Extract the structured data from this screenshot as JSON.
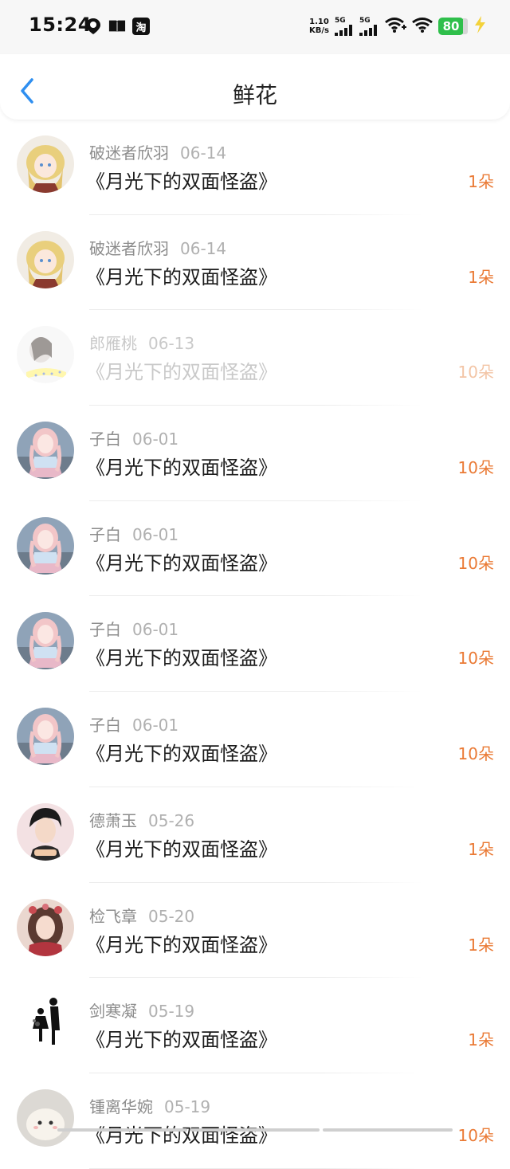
{
  "status_bar": {
    "time": "15:24",
    "net_speed_value": "1.10",
    "net_speed_unit": "KB/s",
    "signal_1": "5G",
    "signal_2": "5G",
    "battery": "80",
    "left_icons": [
      "location-du-icon",
      "book-icon",
      "taobao-icon"
    ],
    "taobao_label": "淘"
  },
  "nav": {
    "title": "鲜花"
  },
  "records": [
    {
      "user": "破迷者欣羽",
      "date": "06-14",
      "book": "《月光下的双面怪盗》",
      "amount": "1朵",
      "avatar": "anime-blonde-girl"
    },
    {
      "user": "破迷者欣羽",
      "date": "06-14",
      "book": "《月光下的双面怪盗》",
      "amount": "1朵",
      "avatar": "anime-blonde-girl"
    },
    {
      "user": "郎雁桃",
      "date": "06-13",
      "book": "《月光下的双面怪盗》",
      "amount": "10朵",
      "avatar": "sketch-girl",
      "faded": true
    },
    {
      "user": "子白",
      "date": "06-01",
      "book": "《月光下的双面怪盗》",
      "amount": "10朵",
      "avatar": "anime-pink-hair-girl"
    },
    {
      "user": "子白",
      "date": "06-01",
      "book": "《月光下的双面怪盗》",
      "amount": "10朵",
      "avatar": "anime-pink-hair-girl"
    },
    {
      "user": "子白",
      "date": "06-01",
      "book": "《月光下的双面怪盗》",
      "amount": "10朵",
      "avatar": "anime-pink-hair-girl"
    },
    {
      "user": "子白",
      "date": "06-01",
      "book": "《月光下的双面怪盗》",
      "amount": "10朵",
      "avatar": "anime-pink-hair-girl"
    },
    {
      "user": "德萧玉",
      "date": "05-26",
      "book": "《月光下的双面怪盗》",
      "amount": "1朵",
      "avatar": "young-man-portrait"
    },
    {
      "user": "检飞章",
      "date": "05-20",
      "book": "《月光下的双面怪盗》",
      "amount": "1朵",
      "avatar": "painted-girl-flowers"
    },
    {
      "user": "剑寒凝",
      "date": "05-19",
      "book": "《月光下的双面怪盗》",
      "amount": "1朵",
      "avatar": "silhouette-couple"
    },
    {
      "user": "锺离华婉",
      "date": "05-19",
      "book": "《月光下的双面怪盗》",
      "amount": "10朵",
      "avatar": "cute-blob"
    }
  ],
  "colors": {
    "accent_blue": "#2f8ff0",
    "amount_orange": "#ea7a35",
    "battery_green": "#2fbf4b"
  }
}
